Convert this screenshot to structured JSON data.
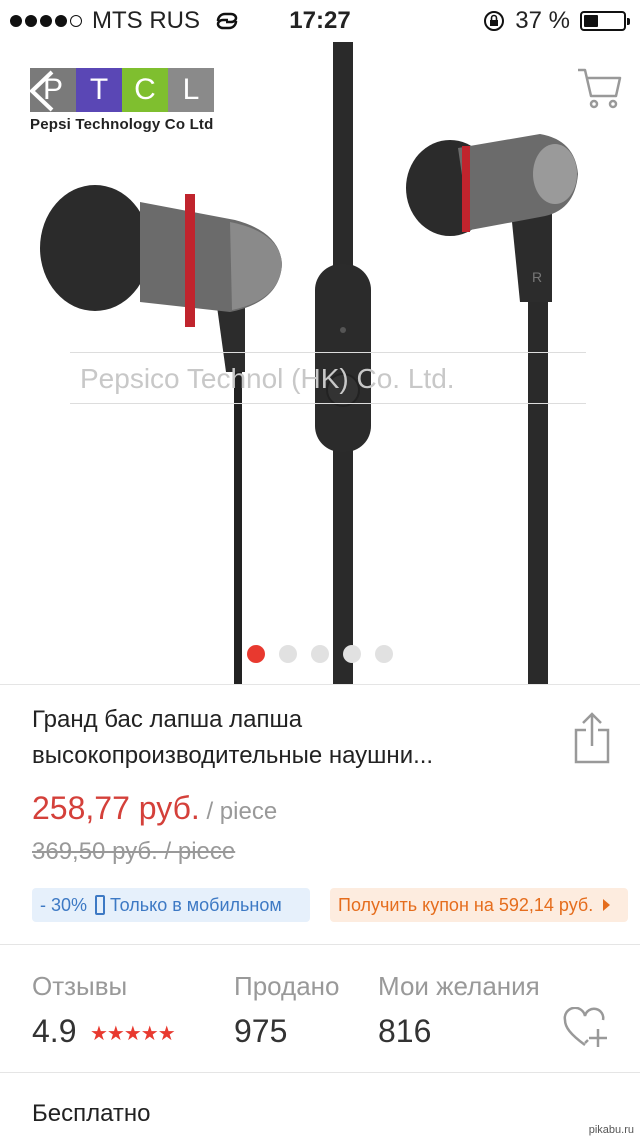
{
  "status_bar": {
    "carrier": "MTS RUS",
    "time": "17:27",
    "battery": "37 %",
    "battery_level": 0.37
  },
  "hero": {
    "logo_letters": [
      "P",
      "T",
      "C",
      "L"
    ],
    "logo_colors": [
      "#7a7a7a",
      "#5a47b5",
      "#7fbf2f",
      "#8a8a8a"
    ],
    "logo_subtitle": "Pepsi Technology Co Ltd",
    "watermark": "Pepsico  Technol    (HK)  Co.  Ltd.",
    "pager_count": 5,
    "pager_active": 0
  },
  "product": {
    "title": "Гранд бас лапша лапша высокопроизводительные наушни...",
    "price": "258,77 руб.",
    "price_unit": " / piece",
    "old_price": "369,50 руб.  / piece",
    "mobile_discount": "- 30%",
    "mobile_only_label": "Только в мобильном",
    "coupon_label": "Получить купон на 592,14 руб."
  },
  "stats": {
    "reviews_label": "Отзывы",
    "rating": "4.9",
    "stars": "★★★★★",
    "sold_label": "Продано",
    "sold_value": "975",
    "wishes_label": "Мои желания",
    "wishes_value": "816"
  },
  "shipping": {
    "label": "Бесплатно"
  },
  "watermark_site": "pikabu.ru",
  "colors": {
    "accent_red": "#e8392f",
    "price_red": "#d4403a",
    "mobile_blue": "#3d79c4",
    "coupon_orange": "#e56d1d"
  }
}
